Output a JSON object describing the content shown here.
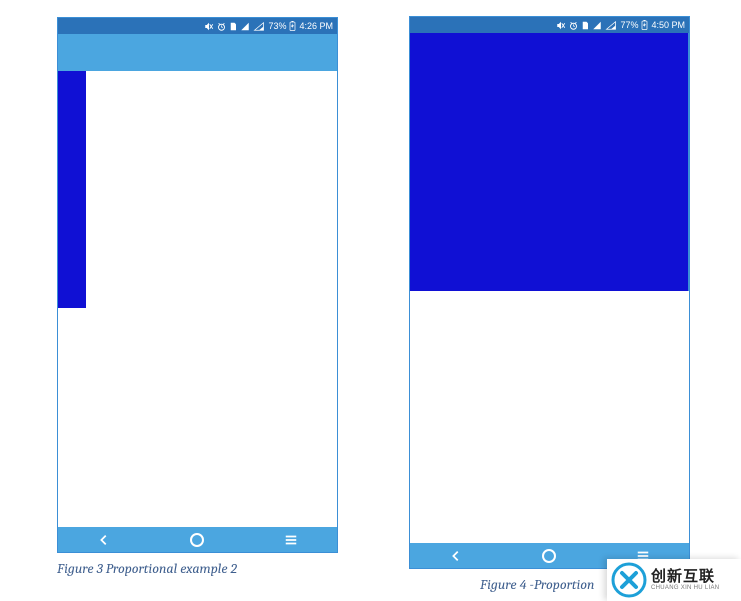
{
  "phones": {
    "left": {
      "status_bar": {
        "icons": [
          "mute-icon",
          "alarm-icon",
          "sd-card-icon",
          "signal-icon",
          "wifi-off-icon"
        ],
        "battery": "73%",
        "battery_charging": true,
        "time": "4:26 PM"
      },
      "nav": [
        "back",
        "home",
        "recents"
      ],
      "blue_block": {
        "orientation": "vertical-strip"
      }
    },
    "right": {
      "status_bar": {
        "icons": [
          "mute-icon",
          "alarm-icon",
          "sd-card-icon",
          "signal-icon",
          "wifi-off-icon"
        ],
        "battery": "77%",
        "battery_charging": true,
        "time": "4:50 PM"
      },
      "nav": [
        "back",
        "home",
        "recents"
      ],
      "blue_block": {
        "orientation": "full-width-top-half"
      }
    }
  },
  "captions": {
    "left": "Figure 3 Proportional example 2",
    "right": "Figure 4 -Proportion"
  },
  "watermark": {
    "cn": "创新互联",
    "en": "CHUANG XIN HU LIAN"
  },
  "colors": {
    "status_bar_bg": "#2b72b8",
    "app_bar_bg": "#4ba6e0",
    "blue_block": "#1010d4",
    "caption_text": "#3f5f8e"
  }
}
